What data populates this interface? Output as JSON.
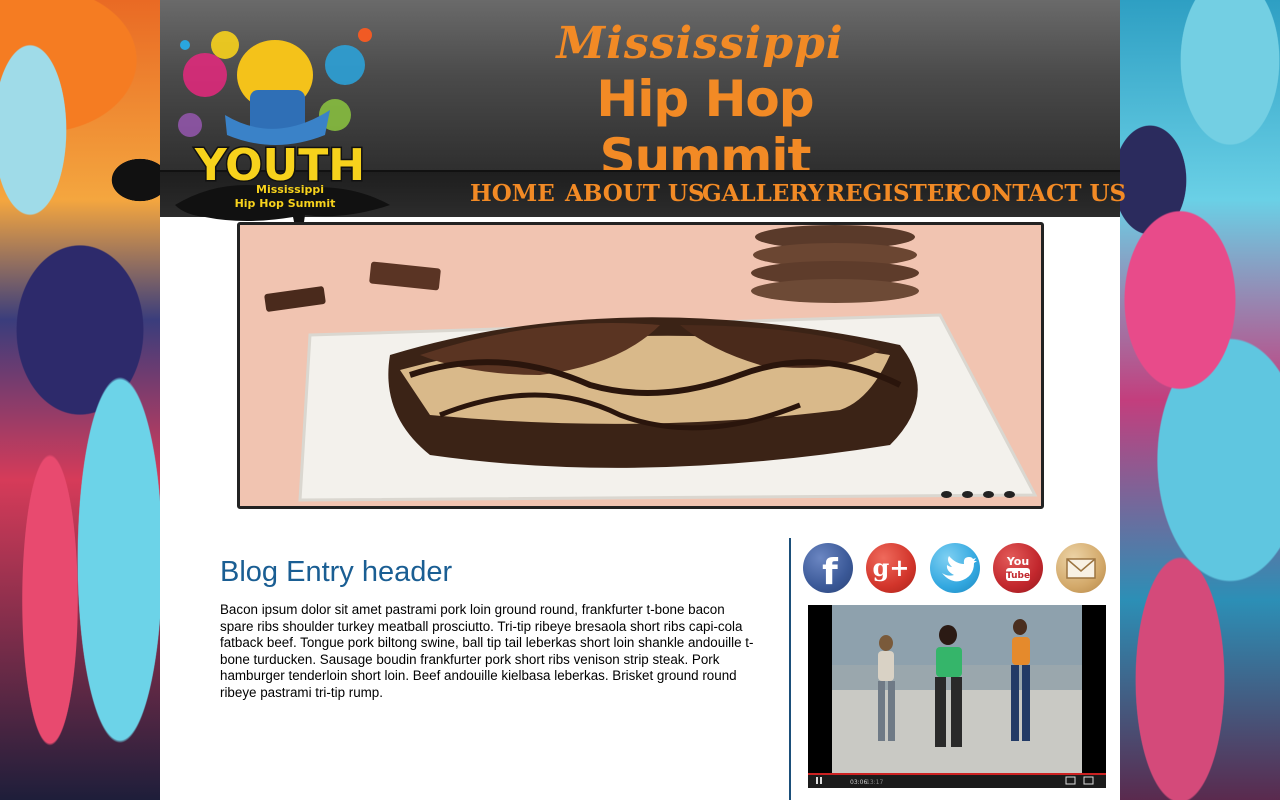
{
  "site": {
    "title_top": "Mississippi",
    "title_main": "Hip Hop Summit",
    "logo_text_big": "YOUTH",
    "logo_text_line1": "Mississippi",
    "logo_text_line2": "Hip Hop Summit"
  },
  "nav": [
    {
      "label": "HOME"
    },
    {
      "label": "ABOUT US"
    },
    {
      "label": "GALLERY"
    },
    {
      "label": "REGISTER"
    },
    {
      "label": "CONTACT US"
    }
  ],
  "slider": {
    "slide_count": 4,
    "active_index": 0,
    "image": "brownie-with-chocolate-drizzle"
  },
  "blog": {
    "header": "Blog Entry header",
    "body": "Bacon ipsum dolor sit amet pastrami pork loin ground round, frankfurter t-bone bacon spare ribs shoulder turkey meatball prosciutto. Tri-tip ribeye bresaola short ribs capi-cola fatback beef. Tongue pork biltong swine, ball tip tail leberkas short loin shankle andouille t-bone turducken. Sausage boudin frankfurter pork short ribs venison strip steak. Pork hamburger tenderloin short loin. Beef andouille kielbasa leberkas. Brisket ground round ribeye pastrami tri-tip rump."
  },
  "social": [
    {
      "name": "facebook-icon",
      "glyph": "f",
      "color": "#3b5998"
    },
    {
      "name": "google-plus-icon",
      "glyph": "g+",
      "color": "#d2352b"
    },
    {
      "name": "twitter-icon",
      "glyph": "🐦",
      "color": "#33a8e0"
    },
    {
      "name": "youtube-icon",
      "glyph": "You Tube",
      "color": "#c2272d"
    },
    {
      "name": "email-icon",
      "glyph": "✉",
      "color": "#d3a96a"
    }
  ],
  "video": {
    "time_current": "03:06",
    "time_total": "13:17"
  }
}
